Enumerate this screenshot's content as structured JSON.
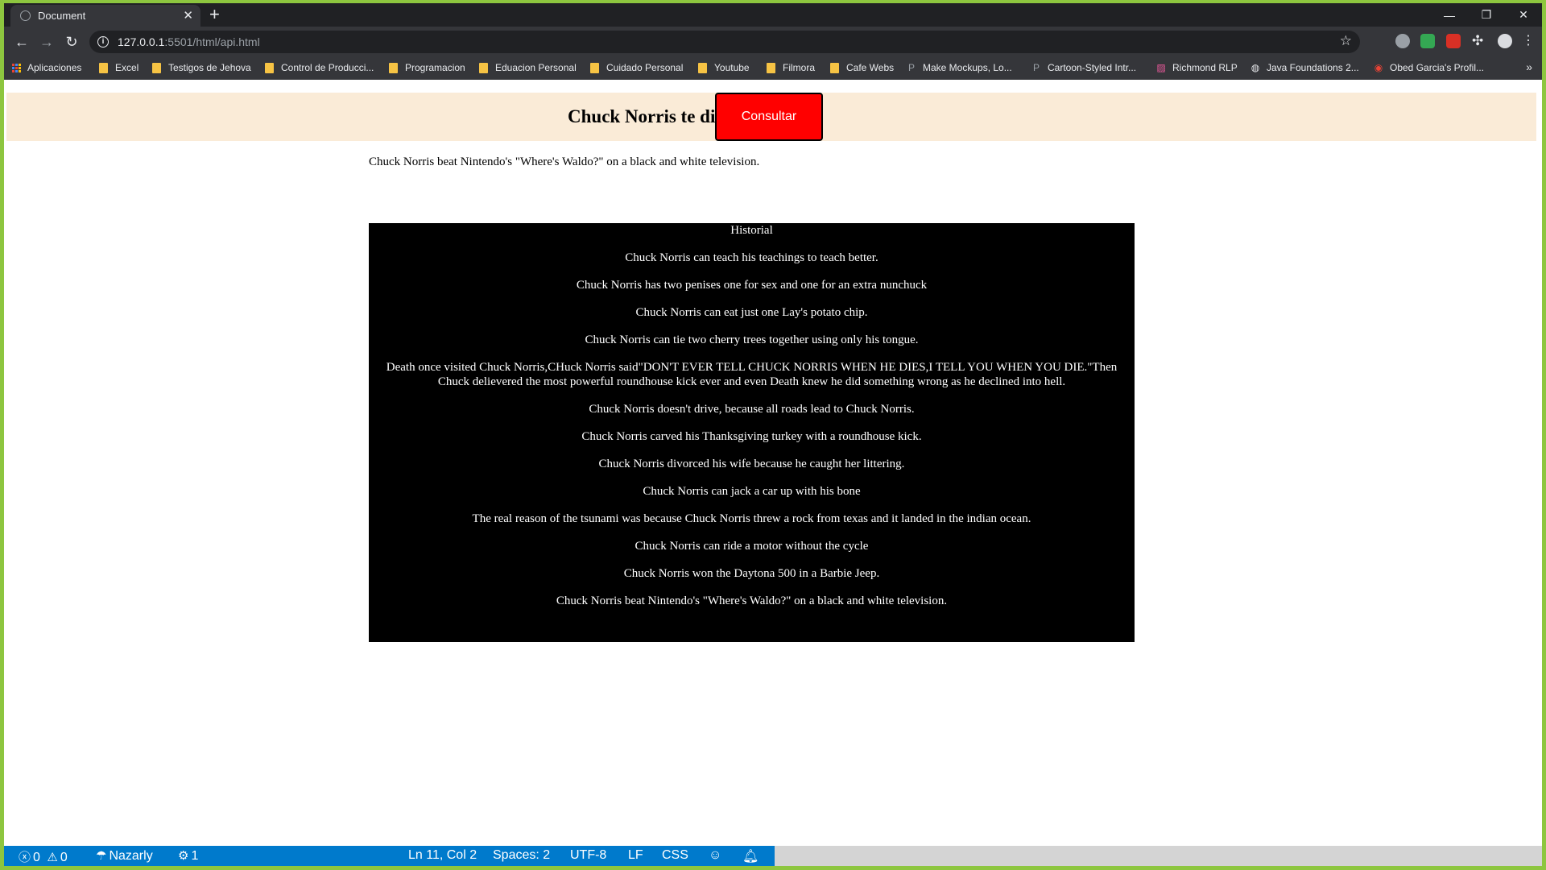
{
  "browser": {
    "tab_title": "Document",
    "url_host": "127.0.0.1",
    "url_path": ":5501/html/api.html",
    "window_controls": [
      "minimize-icon",
      "restore-icon",
      "close-icon"
    ]
  },
  "bookmarks": [
    {
      "label": "Aplicaciones",
      "icon": "apps-icon"
    },
    {
      "label": "Excel",
      "icon": "folder-icon"
    },
    {
      "label": "Testigos de Jehova",
      "icon": "folder-icon"
    },
    {
      "label": "Control de Producci...",
      "icon": "folder-icon"
    },
    {
      "label": "Programacion",
      "icon": "folder-icon"
    },
    {
      "label": "Eduacion Personal",
      "icon": "folder-icon"
    },
    {
      "label": "Cuidado Personal",
      "icon": "folder-icon"
    },
    {
      "label": "Youtube",
      "icon": "folder-icon"
    },
    {
      "label": "Filmora",
      "icon": "folder-icon"
    },
    {
      "label": "Cafe Webs",
      "icon": "folder-icon"
    },
    {
      "label": "Make Mockups, Lo...",
      "icon": "site-icon"
    },
    {
      "label": "Cartoon-Styled Intr...",
      "icon": "site-icon"
    },
    {
      "label": "Richmond RLP",
      "icon": "site-icon"
    },
    {
      "label": "Java Foundations 2...",
      "icon": "site-icon"
    },
    {
      "label": "Obed Garcia's Profil...",
      "icon": "site-icon"
    }
  ],
  "page": {
    "header_title": "Chuck Norris te dice:",
    "button_label": "Consultar",
    "current_joke": "Chuck Norris beat Nintendo's \"Where's Waldo?\" on a black and white television.",
    "historial_title": "Historial",
    "historial": [
      "Chuck Norris can teach his teachings to teach better.",
      "Chuck Norris has two penises one for sex and one for an extra nunchuck",
      "Chuck Norris can eat just one Lay's potato chip.",
      "Chuck Norris can tie two cherry trees together using only his tongue.",
      "Death once visited Chuck Norris,CHuck Norris said\"DON'T EVER TELL CHUCK NORRIS WHEN HE DIES,I TELL YOU WHEN YOU DIE.\"Then Chuck delievered the most powerful roundhouse kick ever and even Death knew he did something wrong as he declined into hell.",
      "Chuck Norris doesn't drive, because all roads lead to Chuck Norris.",
      "Chuck Norris carved his Thanksgiving turkey with a roundhouse kick.",
      "Chuck Norris divorced his wife because he caught her littering.",
      "Chuck Norris can jack a car up with his bone",
      "The real reason of the tsunami was because Chuck Norris threw a rock from texas and it landed in the indian ocean.",
      "Chuck Norris can ride a motor without the cycle",
      "Chuck Norris won the Daytona 500 in a Barbie Jeep.",
      "Chuck Norris beat Nintendo's \"Where's Waldo?\" on a black and white television."
    ],
    "colors": {
      "header_bg": "#faebd7",
      "button_bg": "#ff0000",
      "historial_bg": "#000000"
    }
  },
  "statusbar": {
    "errors": "0",
    "warnings": "0",
    "user": "Nazarly",
    "ports": "1",
    "position": "Ln 11, Col 2",
    "spaces": "Spaces: 2",
    "encoding": "UTF-8",
    "eol": "LF",
    "language": "CSS",
    "accent": "#007acc"
  }
}
